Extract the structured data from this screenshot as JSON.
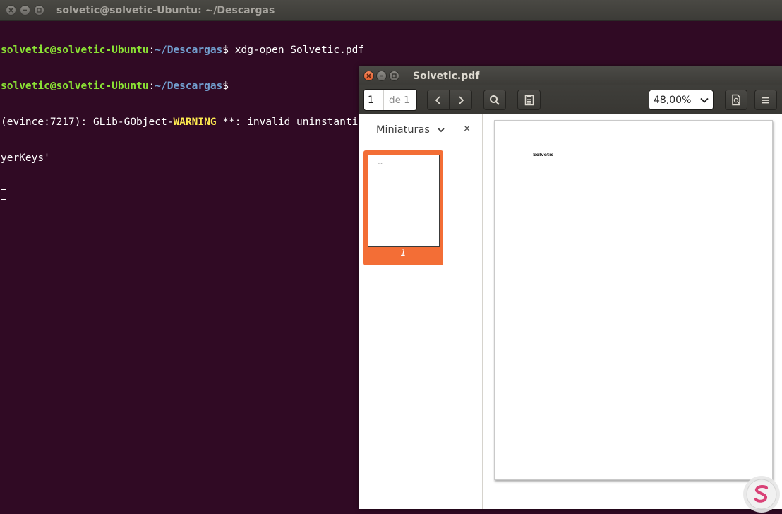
{
  "terminal": {
    "title": "solvetic@solvetic-Ubuntu: ~/Descargas",
    "prompt_user": "solvetic@solvetic-Ubuntu",
    "prompt_sep": ":",
    "prompt_path": "~/Descargas",
    "prompt_dollar": "$",
    "command": " xdg-open Solvetic.pdf",
    "warning_prefix": "(evince:7217): GLib-GObject-",
    "warning_word": "WARNING",
    "warning_rest": " **: invalid uninstantiatable type '-g-type-private--GTypeFlags' in cast to 'EvMediaPla",
    "warning_cont": "yerKeys'"
  },
  "evince": {
    "title": "Solvetic.pdf",
    "page_current": "1",
    "page_of": "de 1",
    "zoom": "48,00%",
    "sidebar_label": "Miniaturas",
    "close_glyph": "×",
    "thumb_page_number": "1",
    "thumb_text": "...",
    "doc_text": "Solvetic"
  },
  "colors": {
    "terminal_bg": "#300a24",
    "prompt_user": "#8ae234",
    "prompt_path": "#729fcf",
    "warning": "#fce94f",
    "thumb_highlight": "#f36e36"
  },
  "icons": {
    "close": "close-icon",
    "minimize": "minimize-icon",
    "maximize": "maximize-icon",
    "prev": "chevron-left-icon",
    "next": "chevron-right-icon",
    "search": "search-icon",
    "annotations": "clipboard-icon",
    "zoom_dropdown": "chevron-down-icon",
    "document_props": "document-icon",
    "menu": "hamburger-menu-icon",
    "logo": "solvetic-logo-icon"
  }
}
